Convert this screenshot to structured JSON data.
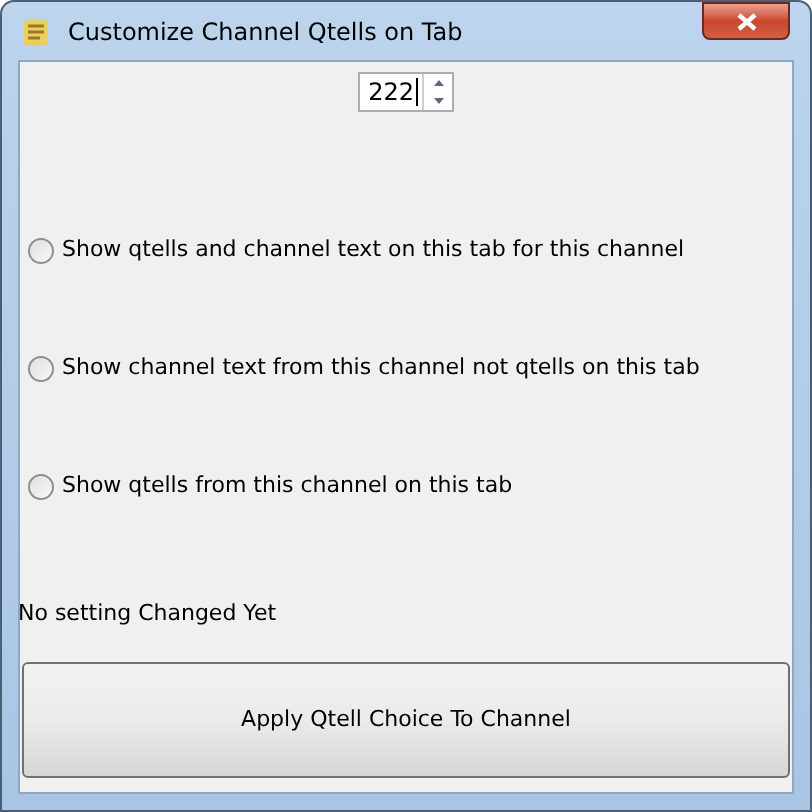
{
  "window": {
    "title": "Customize Channel Qtells on Tab"
  },
  "spinner": {
    "value": "222"
  },
  "options": [
    {
      "label": "Show qtells and channel text on this tab for this channel",
      "selected": false
    },
    {
      "label": "Show channel text from this channel not qtells on this tab",
      "selected": false
    },
    {
      "label": "Show qtells from this channel on this tab",
      "selected": false
    }
  ],
  "status": "No setting Changed Yet",
  "apply_button": "Apply Qtell Choice To Channel"
}
